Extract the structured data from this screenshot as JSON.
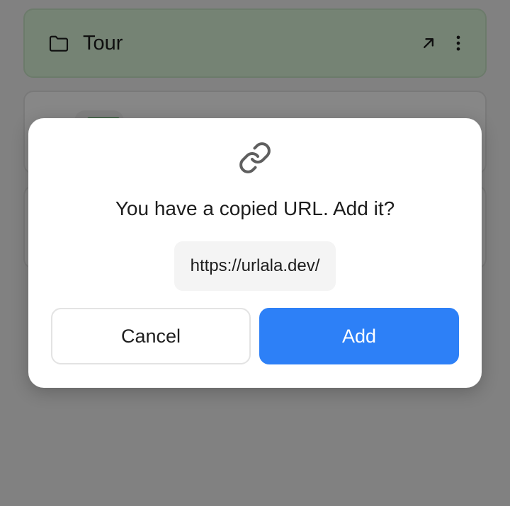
{
  "background": {
    "folder_card": {
      "title": "Tour",
      "folder_icon": "folder-icon",
      "open_icon": "arrow-up-right-icon",
      "menu_icon": "more-vertical-icon"
    }
  },
  "dialog": {
    "icon": "link-icon",
    "title": "You have a copied URL. Add it?",
    "url": "https://urlala.dev/",
    "cancel_label": "Cancel",
    "add_label": "Add"
  },
  "colors": {
    "folder_card_bg": "#def7dc",
    "primary_button": "#2d80f7",
    "overlay": "rgba(0,0,0,0.47)"
  }
}
